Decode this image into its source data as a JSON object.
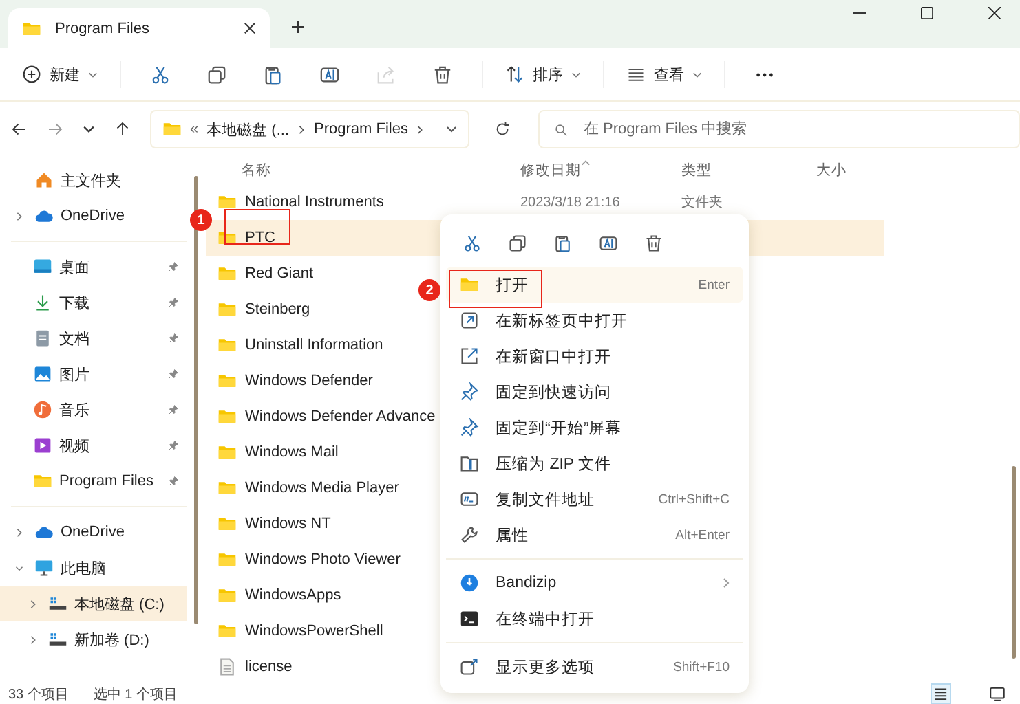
{
  "tab": {
    "title": "Program Files"
  },
  "toolbar": [
    {
      "kind": "menu",
      "label": "新建",
      "disabled": false
    },
    {
      "kind": "icon",
      "disabled": false
    },
    {
      "kind": "icon",
      "disabled": false
    },
    {
      "kind": "icon",
      "disabled": false
    },
    {
      "kind": "icon",
      "disabled": false
    },
    {
      "kind": "icon",
      "disabled": true
    },
    {
      "kind": "icon",
      "disabled": false
    },
    {
      "kind": "menu",
      "label": "排序",
      "disabled": false
    },
    {
      "kind": "menu",
      "label": "查看",
      "disabled": false
    },
    {
      "kind": "icon",
      "disabled": false
    }
  ],
  "address": {
    "overflow": "«",
    "crumbs": [
      "本地磁盘 (...",
      "Program Files"
    ],
    "search_placeholder": "在 Program Files 中搜索"
  },
  "sidebar": {
    "groups": [
      [
        {
          "label": "主文件夹",
          "pinned": false,
          "selected": false
        },
        {
          "label": "OneDrive",
          "pinned": false,
          "selected": false,
          "expanded": false
        }
      ],
      [
        {
          "label": "桌面",
          "pinned": true,
          "selected": false
        },
        {
          "label": "下载",
          "pinned": true,
          "selected": false
        },
        {
          "label": "文档",
          "pinned": true,
          "selected": false
        },
        {
          "label": "图片",
          "pinned": true,
          "selected": false
        },
        {
          "label": "音乐",
          "pinned": true,
          "selected": false
        },
        {
          "label": "视频",
          "pinned": true,
          "selected": false
        },
        {
          "label": "Program Files",
          "pinned": true,
          "selected": false
        }
      ],
      [
        {
          "label": "OneDrive",
          "pinned": false,
          "selected": false,
          "expanded": false
        },
        {
          "label": "此电脑",
          "pinned": false,
          "selected": false,
          "expanded": true,
          "children": [
            {
              "label": "本地磁盘 (C:)",
              "pinned": false,
              "selected": true,
              "expanded": false
            },
            {
              "label": "新加卷 (D:)",
              "pinned": false,
              "selected": false,
              "expanded": false
            }
          ]
        }
      ]
    ]
  },
  "table": {
    "columns": [
      "名称",
      "修改日期",
      "类型",
      "大小"
    ],
    "rows": [
      {
        "name": "National Instruments",
        "kind": "folder",
        "date": "2023/3/18 21:16",
        "type": "文件夹",
        "selected": false
      },
      {
        "name": "PTC",
        "kind": "folder",
        "selected": true
      },
      {
        "name": "Red Giant",
        "kind": "folder",
        "selected": false
      },
      {
        "name": "Steinberg",
        "kind": "folder",
        "selected": false
      },
      {
        "name": "Uninstall Information",
        "kind": "folder",
        "selected": false
      },
      {
        "name": "Windows Defender",
        "kind": "folder",
        "selected": false
      },
      {
        "name": "Windows Defender Advance",
        "kind": "folder",
        "selected": false
      },
      {
        "name": "Windows Mail",
        "kind": "folder",
        "selected": false
      },
      {
        "name": "Windows Media Player",
        "kind": "folder",
        "selected": false
      },
      {
        "name": "Windows NT",
        "kind": "folder",
        "selected": false
      },
      {
        "name": "Windows Photo Viewer",
        "kind": "folder",
        "selected": false
      },
      {
        "name": "WindowsApps",
        "kind": "folder",
        "selected": false
      },
      {
        "name": "WindowsPowerShell",
        "kind": "folder",
        "selected": false
      },
      {
        "name": "license",
        "kind": "file",
        "selected": false
      }
    ]
  },
  "context_menu": {
    "groups": [
      [
        {
          "label": "打开",
          "shortcut": "Enter",
          "selected": true,
          "submenu": false
        },
        {
          "label": "在新标签页中打开",
          "selected": false,
          "submenu": false
        },
        {
          "label": "在新窗口中打开",
          "selected": false,
          "submenu": false
        },
        {
          "label": "固定到快速访问",
          "selected": false,
          "submenu": false
        },
        {
          "label": "固定到“开始”屏幕",
          "selected": false,
          "submenu": false
        },
        {
          "label": "压缩为 ZIP 文件",
          "selected": false,
          "submenu": false
        },
        {
          "label": "复制文件地址",
          "shortcut": "Ctrl+Shift+C",
          "selected": false,
          "submenu": false
        },
        {
          "label": "属性",
          "shortcut": "Alt+Enter",
          "selected": false,
          "submenu": false
        }
      ],
      [
        {
          "label": "Bandizip",
          "selected": false,
          "submenu": true
        },
        {
          "label": "在终端中打开",
          "selected": false,
          "submenu": false
        }
      ],
      [
        {
          "label": "显示更多选项",
          "shortcut": "Shift+F10",
          "selected": false,
          "submenu": false
        }
      ]
    ]
  },
  "annotations": [
    {
      "number": "1"
    },
    {
      "number": "2"
    }
  ],
  "status_bar": {
    "count": "33 个项目",
    "selection": "选中 1 个项目",
    "views": [
      {
        "selected": true
      },
      {
        "selected": false
      }
    ]
  }
}
